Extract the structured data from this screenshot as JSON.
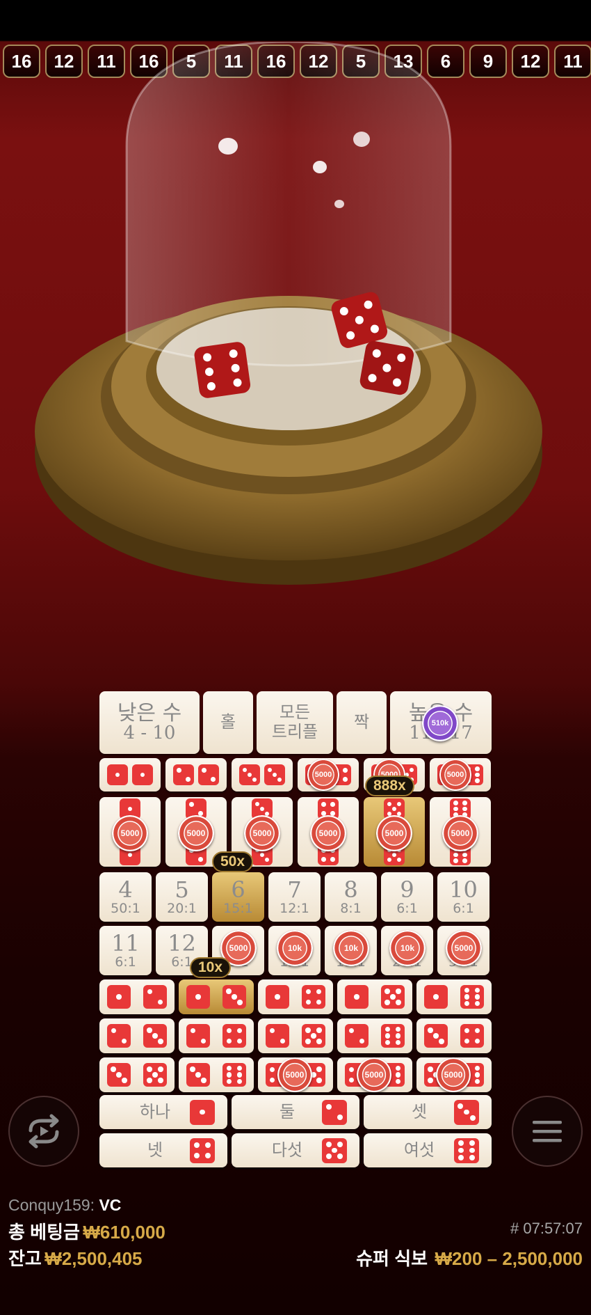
{
  "history": [
    "16",
    "12",
    "11",
    "16",
    "5",
    "11",
    "16",
    "12",
    "5",
    "13",
    "6",
    "9",
    "12",
    "11"
  ],
  "outside_bets": {
    "small": {
      "label": "낮은 수",
      "range": "4 - 10"
    },
    "odd": {
      "label": "홀"
    },
    "any_triple": {
      "label_line1": "모든",
      "label_line2": "트리플"
    },
    "even": {
      "label": "짝"
    },
    "big": {
      "label": "높은 수",
      "range": "11 - 17"
    }
  },
  "totals": [
    {
      "total": "4",
      "odds": "50:1"
    },
    {
      "total": "5",
      "odds": "20:1"
    },
    {
      "total": "6",
      "odds": "15:1"
    },
    {
      "total": "7",
      "odds": "12:1"
    },
    {
      "total": "8",
      "odds": "8:1"
    },
    {
      "total": "9",
      "odds": "6:1"
    },
    {
      "total": "10",
      "odds": "6:1"
    },
    {
      "total": "11",
      "odds": "6:1"
    },
    {
      "total": "12",
      "odds": "6:1"
    },
    {
      "total": "13",
      "odds": "8:1"
    },
    {
      "total": "14",
      "odds": "12:1"
    },
    {
      "total": "15",
      "odds": "15:1"
    },
    {
      "total": "16",
      "odds": "20:1"
    },
    {
      "total": "17",
      "odds": "50:1"
    }
  ],
  "multipliers": {
    "triple": "888x",
    "total": "50x",
    "combo": "10x"
  },
  "chips": {
    "big": "510k",
    "std": "5000",
    "tenk": "10k"
  },
  "single_bets": [
    {
      "label": "하나",
      "pips": 1
    },
    {
      "label": "둘",
      "pips": 2
    },
    {
      "label": "셋",
      "pips": 3
    },
    {
      "label": "넷",
      "pips": 4
    },
    {
      "label": "다섯",
      "pips": 5
    },
    {
      "label": "여섯",
      "pips": 6
    }
  ],
  "footer": {
    "username": "Conquy159:",
    "user_tag": "VC",
    "total_bet_label": "총 베팅금",
    "total_bet_value": "₩610,000",
    "balance_label": "잔고",
    "balance_value": "₩2,500,405",
    "round_id": "# 07:57:07",
    "game_name": "슈퍼 식보",
    "limits": "₩200 – 2,500,000"
  },
  "icons": {
    "repeat": "repeat-icon",
    "menu": "menu-icon"
  },
  "colors": {
    "accent_gold": "#d7aa48",
    "dice_red": "#e83838",
    "felt": "#7a1010"
  }
}
